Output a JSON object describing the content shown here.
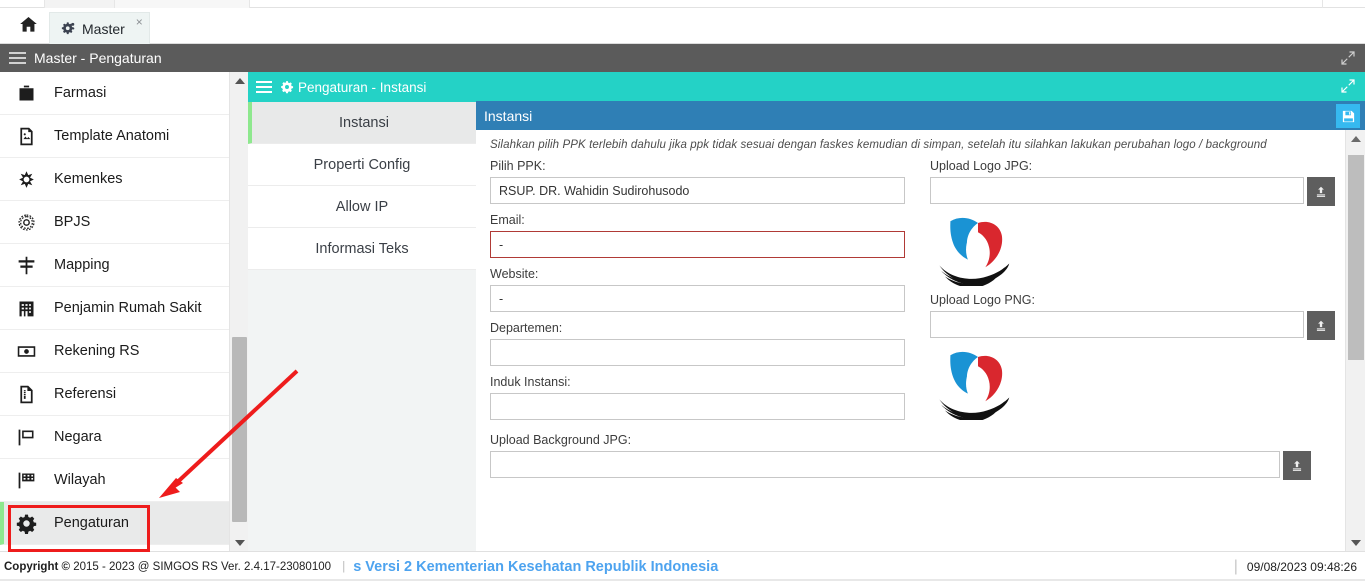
{
  "browser": {
    "tab_label": "Master",
    "tab_close": "×",
    "home_icon": "home-icon",
    "tab_icon": "gears-icon"
  },
  "appheader": {
    "title": "Master - Pengaturan",
    "menu_icon": "hamburger-icon",
    "expand_icon": "expand-arrows-icon"
  },
  "sidebar": {
    "items": [
      {
        "label": "Farmasi",
        "icon": "first-aid-kit-icon",
        "active": false
      },
      {
        "label": "Template Anatomi",
        "icon": "image-file-icon",
        "active": false
      },
      {
        "label": "Kemenkes",
        "icon": "kemenkes-logo-icon",
        "active": false
      },
      {
        "label": "BPJS",
        "icon": "bpjs-gear-icon",
        "active": false
      },
      {
        "label": "Mapping",
        "icon": "signpost-icon",
        "active": false
      },
      {
        "label": "Penjamin Rumah Sakit",
        "icon": "hospital-building-icon",
        "active": false
      },
      {
        "label": "Rekening RS",
        "icon": "banknote-icon",
        "active": false
      },
      {
        "label": "Referensi",
        "icon": "document-icon",
        "active": false
      },
      {
        "label": "Negara",
        "icon": "flag-icon",
        "active": false
      },
      {
        "label": "Wilayah",
        "icon": "checkered-flag-icon",
        "active": false
      },
      {
        "label": "Pengaturan",
        "icon": "gear-icon",
        "active": true
      }
    ]
  },
  "submenu": {
    "header_title": "Pengaturan - Instansi",
    "header_icon": "gear-icon",
    "menu_icon": "hamburger-icon",
    "items": [
      {
        "label": "Instansi",
        "active": true
      },
      {
        "label": "Properti Config",
        "active": false
      },
      {
        "label": "Allow IP",
        "active": false
      },
      {
        "label": "Informasi Teks",
        "active": false
      }
    ]
  },
  "content": {
    "panel_title": "Instansi",
    "save_icon": "floppy-save-icon",
    "expand_icon": "expand-arrows-icon",
    "note": "Silahkan pilih PPK terlebih dahulu jika ppk tidak sesuai dengan faskes kemudian di simpan, setelah itu silahkan lakukan perubahan logo / background",
    "fields_left": [
      {
        "label": "Pilih PPK:",
        "value": "RSUP. DR. Wahidin Sudirohusodo",
        "placeholder": "",
        "error": false,
        "name": "pilih-ppk-input"
      },
      {
        "label": "Email:",
        "value": "-",
        "placeholder": "",
        "error": true,
        "name": "email-input"
      },
      {
        "label": "Website:",
        "value": "-",
        "placeholder": "",
        "error": false,
        "name": "website-input"
      },
      {
        "label": "Departemen:",
        "value": "",
        "placeholder": "",
        "error": false,
        "name": "departemen-input"
      },
      {
        "label": "Induk Instansi:",
        "value": "",
        "placeholder": "",
        "error": false,
        "name": "induk-instansi-input"
      }
    ],
    "uploads_right": [
      {
        "label": "Upload Logo JPG:",
        "value": "",
        "placeholder": "",
        "name": "upload-logo-jpg-input"
      },
      {
        "label": "Upload Logo PNG:",
        "value": "",
        "placeholder": "",
        "name": "upload-logo-png-input"
      }
    ],
    "upload_wide": {
      "label": "Upload Background JPG:",
      "value": "",
      "placeholder": "",
      "name": "upload-background-jpg-input"
    },
    "upload_icon": "upload-icon",
    "logo_preview_alt": "hospital-logo-preview"
  },
  "footer": {
    "copyright_prefix": "Copyright",
    "copyright_symbol": "©",
    "copyright_text": "2015 - 2023 @ SIMGOS RS Ver. 2.4.17-23080100",
    "separator": "|",
    "blue_text": "s Versi 2 Kementerian Kesehatan Republik Indonesia",
    "timestamp": "09/08/2023 09:48:26"
  },
  "annotation": {
    "arrow_color": "#ee1c1c",
    "rect_color": "#ee1c1c"
  },
  "colors": {
    "teal": "#24d2c6",
    "blue_bar": "#2f7fb5",
    "save_blue": "#36b9f0",
    "header_gray": "#5b5b5b",
    "active_green": "#8ee88e",
    "error_red": "#b03a36",
    "footer_blue": "#4da3ef"
  }
}
